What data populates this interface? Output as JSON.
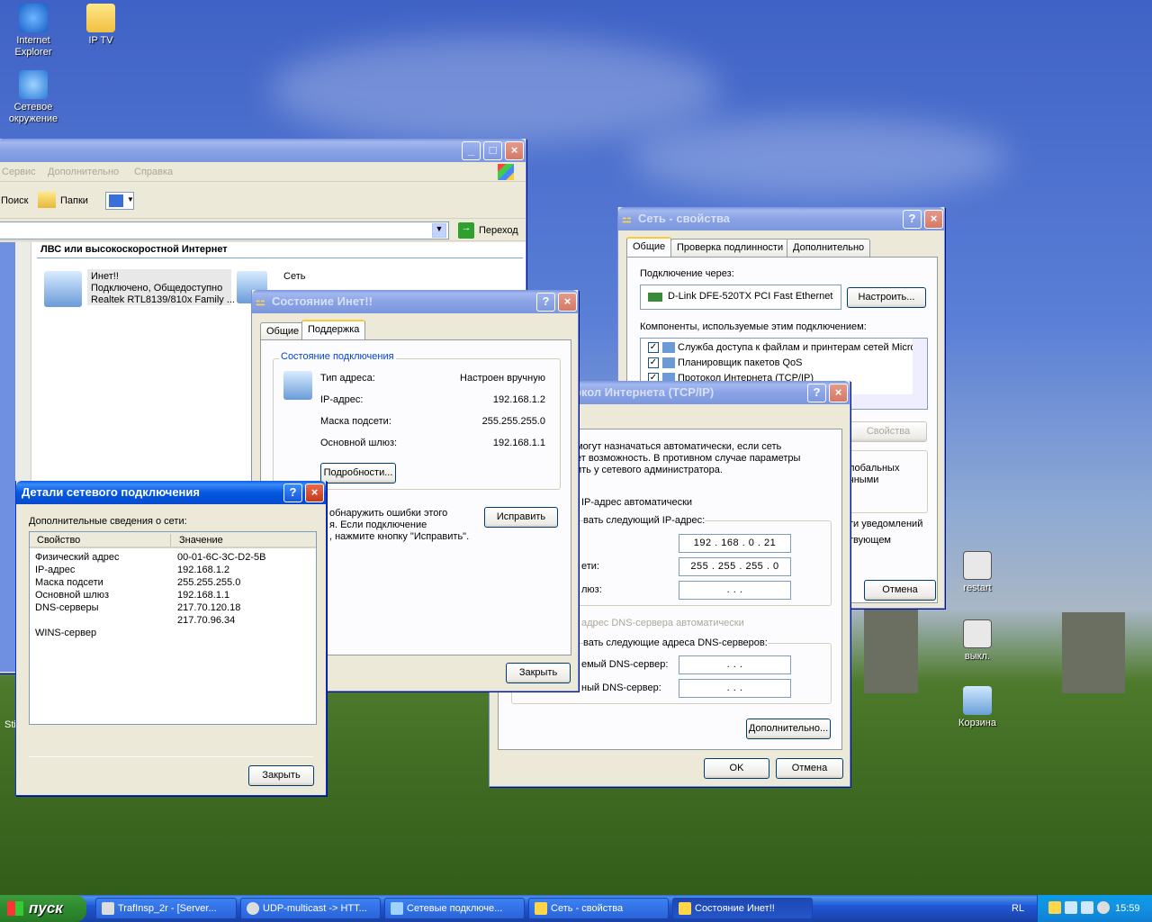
{
  "desktop": {
    "icons": [
      {
        "label_1": "Internet",
        "label_2": "Explorer",
        "icon": "internet-explorer-icon"
      },
      {
        "label": "IP TV",
        "icon": "folder-icon"
      },
      {
        "label_1": "Сетевое",
        "label_2": "окружение",
        "icon": "network-places-icon"
      },
      {
        "label": "restart",
        "icon": "batch-file-icon"
      },
      {
        "label": "выкл.",
        "icon": "batch-file-icon"
      },
      {
        "label": "Корзина",
        "icon": "recycle-bin-icon"
      }
    ],
    "partial_label": "Sti"
  },
  "explorer": {
    "menu": [
      "Сервис",
      "Дополнительно",
      "Справка"
    ],
    "toolbar": {
      "search": "Поиск",
      "folders": "Папки"
    },
    "go_label": "Переход",
    "section_header": "ЛВС или высокоскоростной Интернет",
    "conn1": {
      "name": "Инет!!",
      "status": "Подключено, Общедоступно",
      "adapter": "Realtek RTL8139/810x Family ..."
    },
    "conn2": {
      "name": "Сеть"
    }
  },
  "props": {
    "title": "Сеть - свойства",
    "tabs": [
      "Общие",
      "Проверка подлинности",
      "Дополнительно"
    ],
    "connect_via_label": "Подключение через:",
    "adapter": "D-Link DFE-520TX PCI Fast Ethernet",
    "configure_btn": "Настроить...",
    "components_label": "Компоненты, используемые этим подключением:",
    "components": [
      "Служба доступа к файлам и принтерам сетей Micro",
      "Планировщик пакетов QoS",
      "Протокол Интернета (TCP/IP)"
    ],
    "properties_btn": "Свойства",
    "desc_1": "лобальных",
    "desc_2": "чными",
    "notify_1": "ти уведомлений",
    "notify_2": "твующем",
    "cancel_btn": "Отмена"
  },
  "status": {
    "title": "Состояние Инет!!",
    "tabs": [
      "Общие",
      "Поддержка"
    ],
    "group_title": "Состояние подключения",
    "rows": [
      {
        "label": "Тип адреса:",
        "value": "Настроен вручную"
      },
      {
        "label": "IP-адрес:",
        "value": "192.168.1.2"
      },
      {
        "label": "Маска подсети:",
        "value": "255.255.255.0"
      },
      {
        "label": "Основной шлюз:",
        "value": "192.168.1.1"
      }
    ],
    "details_btn": "Подробности...",
    "repair_text_1": "обнаружить ошибки этого",
    "repair_text_2": "я. Если подключение",
    "repair_text_3": ", нажмите кнопку \"Исправить\".",
    "repair_btn": "Исправить",
    "close_btn": "Закрыть"
  },
  "tcpip": {
    "title": "окол Интернета (TCP/IP)",
    "intro_1": "могут назначаться автоматически, если сеть",
    "intro_2": "ет возможность. В противном случае параметры",
    "intro_3": "ить у сетевого администратора.",
    "auto_ip": "IP-адрес автоматически",
    "use_ip": "вать следующий IP-адрес:",
    "mask_label": "ети:",
    "gw_label": "люз:",
    "ip_value": "192 . 168 .  0  .  21",
    "mask_value": "255 . 255 . 255 .  0",
    "gw_value": ".       .       .",
    "auto_dns": "адрес DNS-сервера автоматически",
    "use_dns": "вать следующие адреса DNS-серверов:",
    "dns1_label": "емый DNS-сервер:",
    "dns2_label": "ный DNS-сервер:",
    "dns1_value": ".       .       .",
    "dns2_value": ".       .       .",
    "advanced_btn": "Дополнительно...",
    "ok_btn": "OK",
    "cancel_btn": "Отмена"
  },
  "details": {
    "title": "Детали сетевого подключения",
    "subtitle": "Дополнительные сведения о сети:",
    "col_prop": "Свойство",
    "col_val": "Значение",
    "rows": [
      {
        "prop": "Физический адрес",
        "val": "00-01-6C-3C-D2-5B"
      },
      {
        "prop": "IP-адрес",
        "val": "192.168.1.2"
      },
      {
        "prop": "Маска подсети",
        "val": "255.255.255.0"
      },
      {
        "prop": "Основной шлюз",
        "val": "192.168.1.1"
      },
      {
        "prop": "DNS-серверы",
        "val": "217.70.120.18"
      },
      {
        "prop": "",
        "val": "217.70.96.34"
      },
      {
        "prop": "WINS-сервер",
        "val": ""
      }
    ],
    "close_btn": "Закрыть"
  },
  "taskbar": {
    "start": "пуск",
    "items": [
      "TrafInsp_2r - [Server...",
      "UDP-multicast -> HTT...",
      "Сетевые подключе...",
      "Сеть - свойства",
      "Состояние Инет!!"
    ],
    "lang": "RL",
    "clock": "15:59"
  }
}
